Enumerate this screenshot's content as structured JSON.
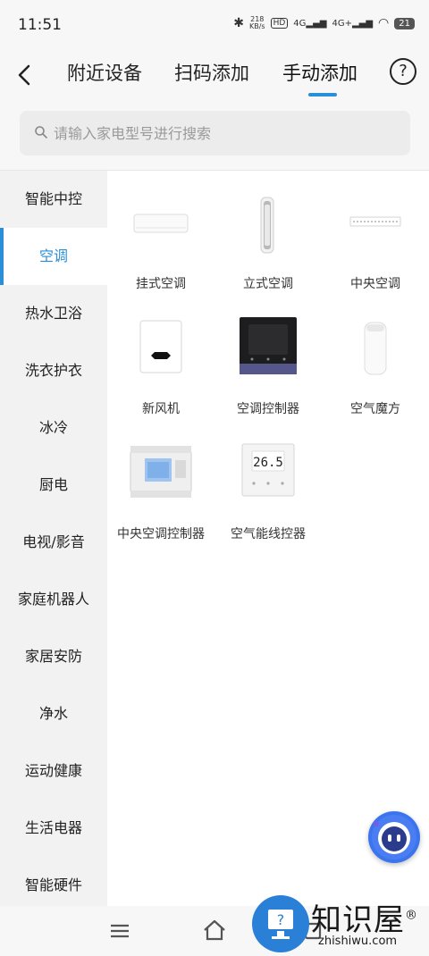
{
  "status_bar": {
    "time": "11:51",
    "net_speed_value": "218",
    "net_speed_unit": "KB/s",
    "hd": "HD",
    "signal_1": "4G",
    "signal_2": "4G+",
    "battery": "21"
  },
  "header": {
    "tabs": [
      {
        "label": "附近设备"
      },
      {
        "label": "扫码添加"
      },
      {
        "label": "手动添加"
      }
    ],
    "active_tab": "手动添加",
    "help_label": "?"
  },
  "search": {
    "placeholder": "请输入家电型号进行搜索"
  },
  "sidebar": {
    "items": [
      {
        "label": "智能中控"
      },
      {
        "label": "空调"
      },
      {
        "label": "热水卫浴"
      },
      {
        "label": "洗衣护衣"
      },
      {
        "label": "冰冷"
      },
      {
        "label": "厨电"
      },
      {
        "label": "电视/影音"
      },
      {
        "label": "家庭机器人"
      },
      {
        "label": "家居安防"
      },
      {
        "label": "净水"
      },
      {
        "label": "运动健康"
      },
      {
        "label": "生活电器"
      },
      {
        "label": "智能硬件"
      }
    ],
    "active_item": "空调"
  },
  "devices": [
    {
      "label": "挂式空调",
      "icon": "wall-ac-icon"
    },
    {
      "label": "立式空调",
      "icon": "floor-ac-icon"
    },
    {
      "label": "中央空调",
      "icon": "central-ac-icon"
    },
    {
      "label": "新风机",
      "icon": "fresh-air-icon"
    },
    {
      "label": "空调控制器",
      "icon": "ac-controller-icon"
    },
    {
      "label": "空气魔方",
      "icon": "air-cube-icon"
    },
    {
      "label": "中央空调控制器",
      "icon": "central-ac-controller-icon"
    },
    {
      "label": "空气能线控器",
      "icon": "air-energy-controller-icon"
    }
  ],
  "thermostat_display": "26.5",
  "watermark": {
    "title": "知识屋",
    "registered": "®",
    "site": "zhishiwu.com"
  },
  "colors": {
    "accent": "#2a8fd8",
    "sidebar_bg": "#f2f2f2",
    "assistant": "#3c74f0"
  }
}
